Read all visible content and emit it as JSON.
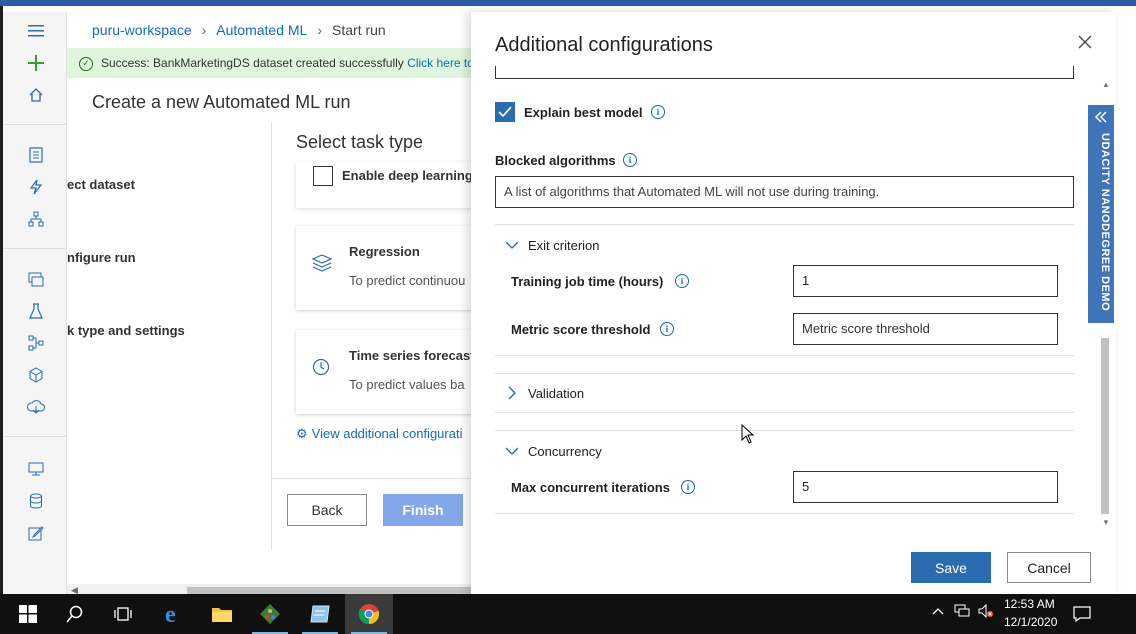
{
  "breadcrumb": {
    "items": [
      "puru-workspace",
      "Automated ML",
      "Start run"
    ]
  },
  "success_banner": {
    "message": "Success: BankMarketingDS dataset created successfully",
    "link": "Click here to g"
  },
  "page_title": "Create a new Automated ML run",
  "steps": [
    "ect dataset",
    "nfigure run",
    "k type and settings"
  ],
  "task_section": {
    "title": "Select task type",
    "deep_learning_label": "Enable deep learning",
    "cards": [
      {
        "title": "Regression",
        "desc": "To predict continuou",
        "icon": "layers-icon"
      },
      {
        "title": "Time series forecast",
        "desc": "To predict values ba",
        "icon": "clock-icon"
      }
    ],
    "view_more": "View additional configurati"
  },
  "footer": {
    "back": "Back",
    "finish": "Finish"
  },
  "panel": {
    "title": "Additional configurations",
    "explain_best_model": {
      "label": "Explain best model",
      "checked": true
    },
    "blocked_algorithms": {
      "label": "Blocked algorithms",
      "placeholder": "A list of algorithms that Automated ML will not use during training."
    },
    "exit_criterion": {
      "title": "Exit criterion",
      "expanded": true,
      "training_job_time": {
        "label": "Training job time (hours)",
        "value": "1"
      },
      "metric_score_threshold": {
        "label": "Metric score threshold",
        "placeholder": "Metric score threshold"
      }
    },
    "validation": {
      "title": "Validation",
      "expanded": false
    },
    "concurrency": {
      "title": "Concurrency",
      "expanded": true,
      "max_concurrent_iterations": {
        "label": "Max concurrent iterations",
        "value": "5"
      }
    },
    "save": "Save",
    "cancel": "Cancel"
  },
  "side_tab": "UDACITY NANODEGREE DEMO",
  "taskbar": {
    "time": "12:53 AM",
    "date": "12/1/2020",
    "apps": [
      "windows-start-icon",
      "search-icon",
      "task-view-icon",
      "edge-browser-icon",
      "file-explorer-icon",
      "git-icon",
      "notepad-icon",
      "chrome-icon"
    ]
  },
  "colors": {
    "accent": "#2b6cb0",
    "success_bg": "#dff6dd",
    "finish_disabled": "#84a6ea",
    "side_tab": "#3d75b8"
  }
}
